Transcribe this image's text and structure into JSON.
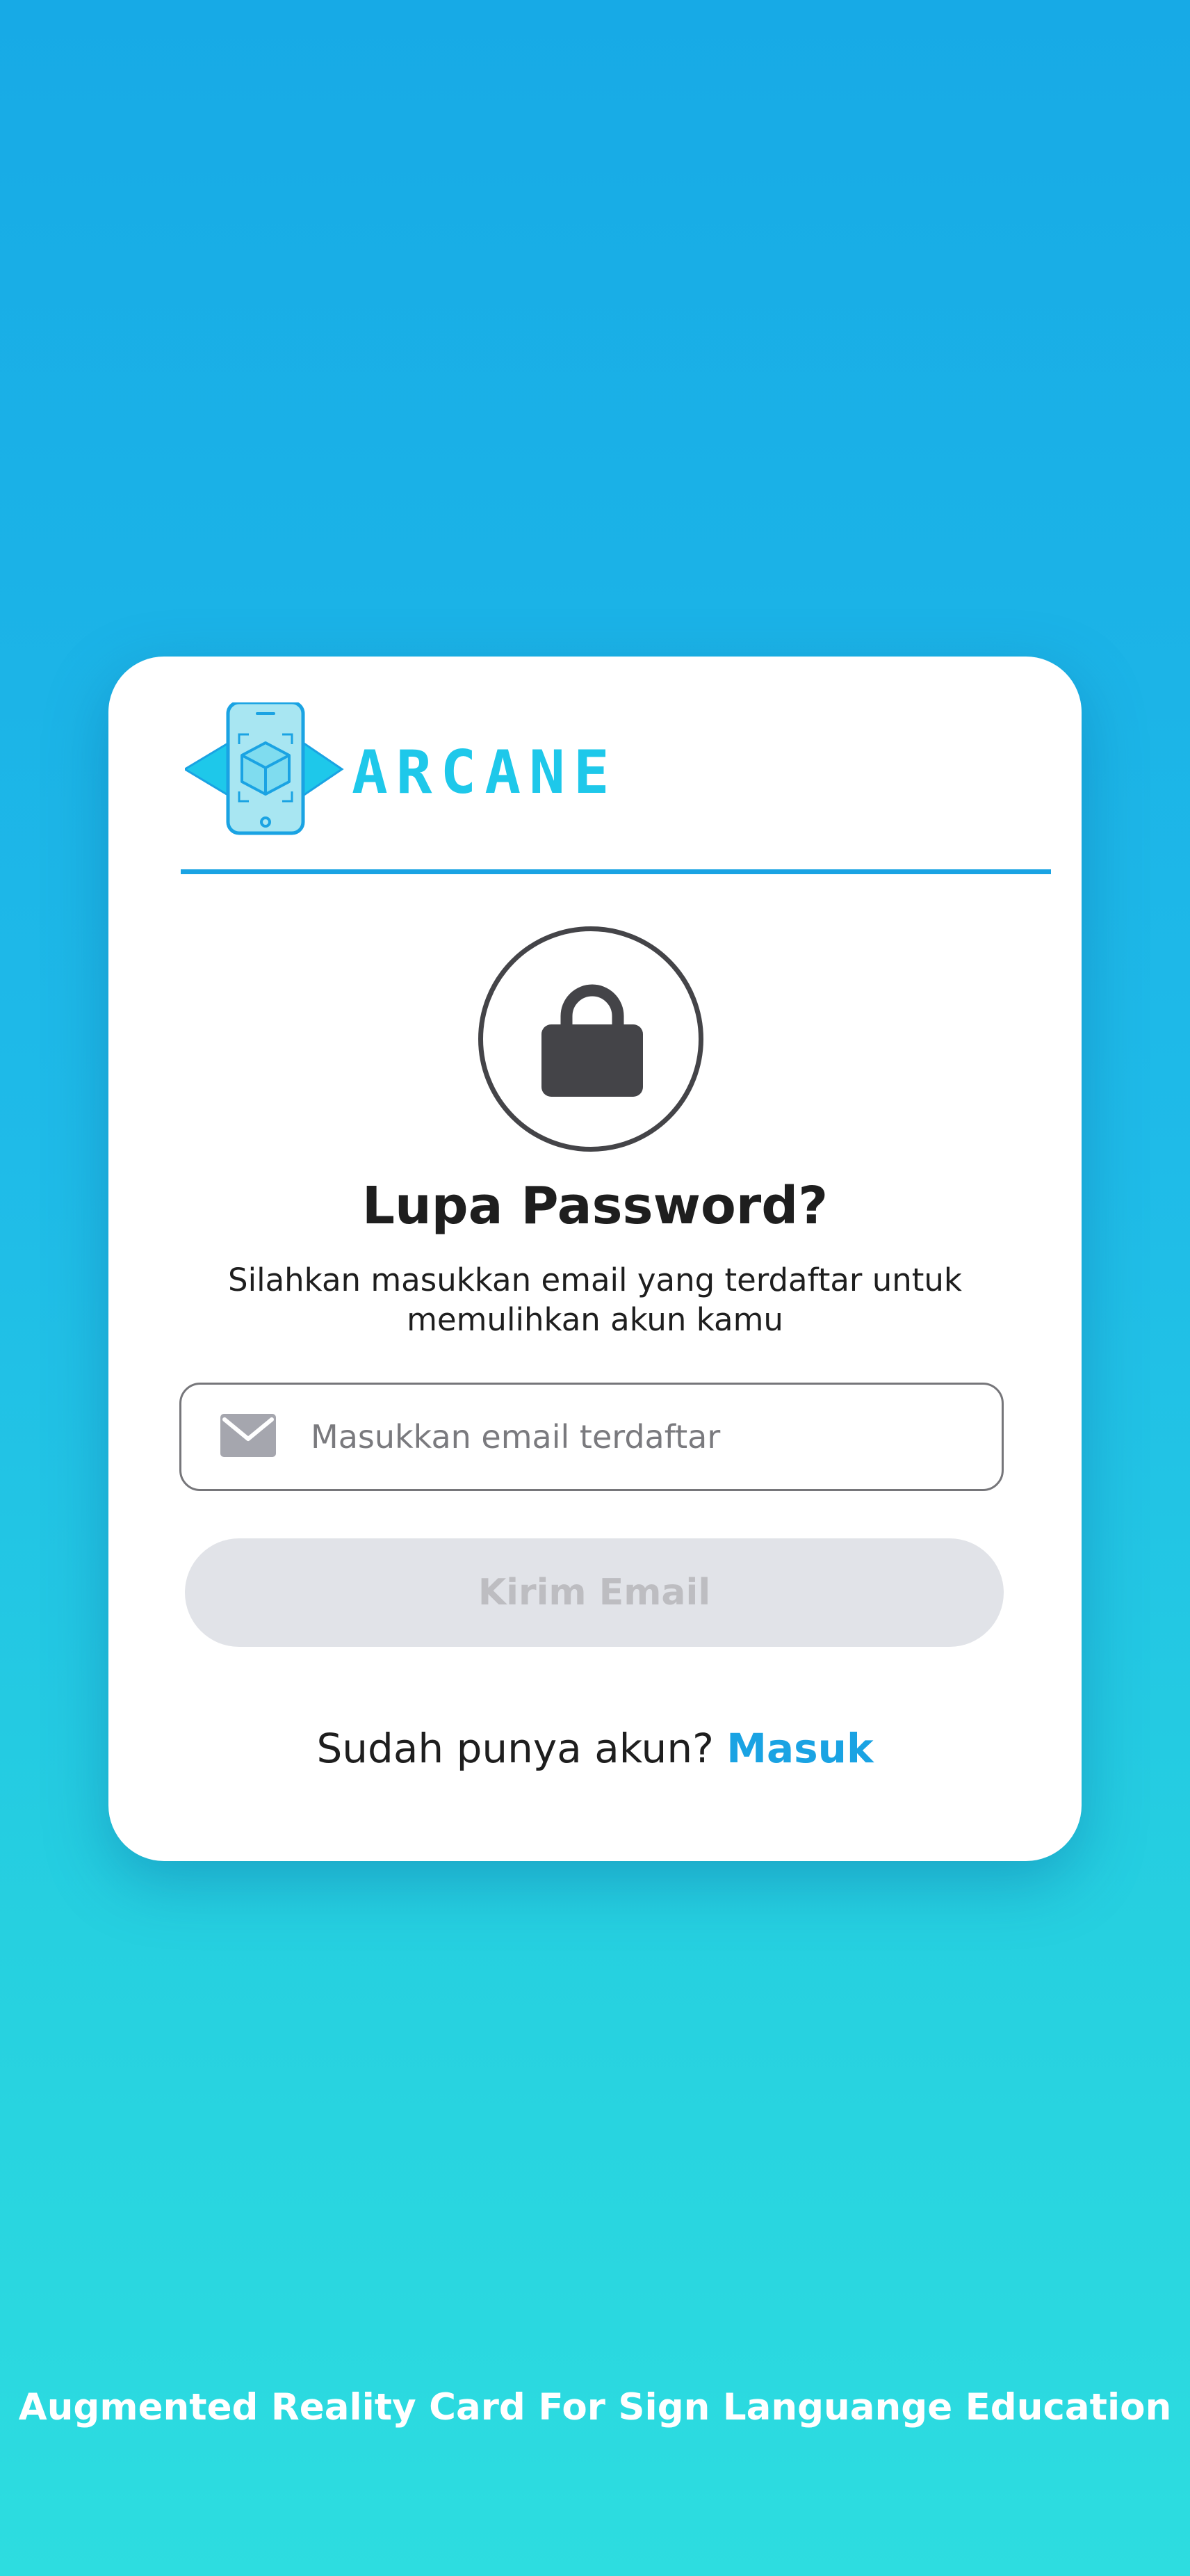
{
  "brand": {
    "name": "ARCANE",
    "logo_icon": "phone-ar-cube-icon",
    "color": "#1ec8ea",
    "dark_color": "#1aa3e3"
  },
  "forgot": {
    "icon": "lock-icon",
    "title": "Lupa Password?",
    "subtitle": "Silahkan masukkan email yang terdaftar untuk memulihkan akun kamu"
  },
  "email": {
    "icon": "mail-icon",
    "placeholder": "Masukkan email terdaftar",
    "value": ""
  },
  "submit": {
    "label": "Kirim Email",
    "state": "disabled"
  },
  "signin": {
    "prompt": "Sudah punya akun?",
    "link_label": "Masuk"
  },
  "footer": {
    "tagline": "Augmented Reality Card For Sign Languange Education"
  },
  "colors": {
    "accent": "#1aa3e3",
    "button_disabled_bg": "#e1e3e8",
    "button_disabled_text": "#bdbdc1",
    "background_top": "#17aae6",
    "background_bottom": "#2ddde0"
  }
}
